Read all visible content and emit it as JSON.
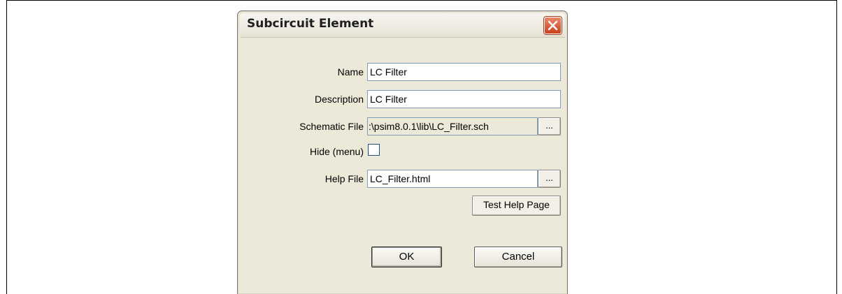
{
  "dialog": {
    "title": "Subcircuit Element",
    "fields": {
      "name": {
        "label": "Name",
        "value": "LC Filter"
      },
      "description": {
        "label": "Description",
        "value": "LC Filter"
      },
      "schematic_file": {
        "label": "Schematic File",
        "value": ":\\psim8.0.1\\lib\\LC_Filter.sch",
        "browse_label": "..."
      },
      "hide_menu": {
        "label": "Hide (menu)",
        "checked": false
      },
      "help_file": {
        "label": "Help File",
        "value": "LC_Filter.html",
        "browse_label": "..."
      }
    },
    "buttons": {
      "test_help_page": "Test Help Page",
      "ok": "OK",
      "cancel": "Cancel"
    },
    "icons": {
      "close": "close-icon"
    },
    "colors": {
      "dialog_bg": "#ECE9D8",
      "close_button": "#c8411c"
    }
  }
}
